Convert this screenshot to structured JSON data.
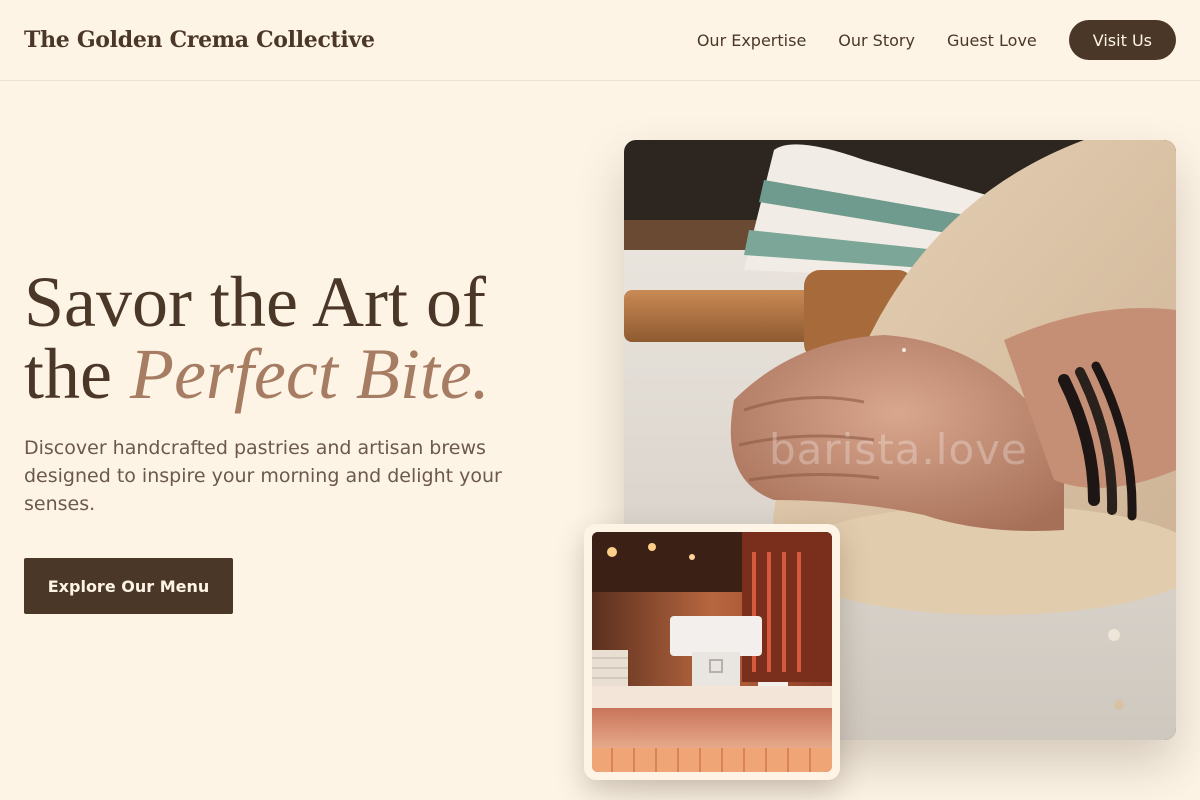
{
  "header": {
    "brand": "The Golden Crema Collective",
    "nav": [
      "Our Expertise",
      "Our Story",
      "Guest Love"
    ],
    "cta": "Visit Us"
  },
  "hero": {
    "title_line1": "Savor the Art of",
    "title_line2_plain": "the ",
    "title_line2_accent": "Perfect Bite.",
    "description": "Discover handcrafted pastries and artisan brews designed to inspire your morning and delight your senses.",
    "button": "Explore Our Menu"
  },
  "images": {
    "main_watermark": "barista.love",
    "main_subject": "hands kneading dough on floured table",
    "inset_subject": "cafe counter with point-of-sale terminal"
  },
  "colors": {
    "background": "#fdf4e6",
    "primary": "#4a3727",
    "accent": "#a67c63",
    "body_text": "#6b594b"
  }
}
